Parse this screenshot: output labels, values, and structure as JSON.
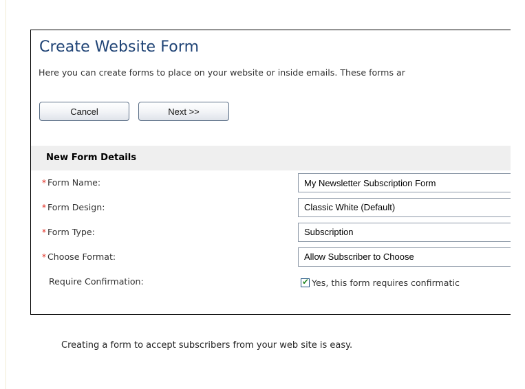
{
  "page": {
    "title": "Create Website Form",
    "intro": "Here you can create forms to place on your website or inside emails. These forms ar",
    "buttons": {
      "cancel": "Cancel",
      "next": "Next >>"
    }
  },
  "section": {
    "title": "New Form Details"
  },
  "fields": {
    "form_name": {
      "label": "Form Name:",
      "value": "My Newsletter Subscription Form",
      "required": "*"
    },
    "form_design": {
      "label": "Form Design:",
      "value": "Classic White (Default)",
      "required": "*"
    },
    "form_type": {
      "label": "Form Type:",
      "value": "Subscription",
      "required": "*"
    },
    "choose_format": {
      "label": "Choose Format:",
      "value": "Allow Subscriber to Choose",
      "required": "*"
    },
    "require_confirmation": {
      "label": "Require Confirmation:",
      "checkbox_label": "Yes, this form requires confirmatic",
      "checked": true
    }
  },
  "footer": {
    "note": "Creating a form to accept subscribers from your web site is easy."
  },
  "colors": {
    "title": "#1f4375",
    "required": "#e02b20",
    "section_bg": "#efefef",
    "check": "#2a8b2a"
  }
}
